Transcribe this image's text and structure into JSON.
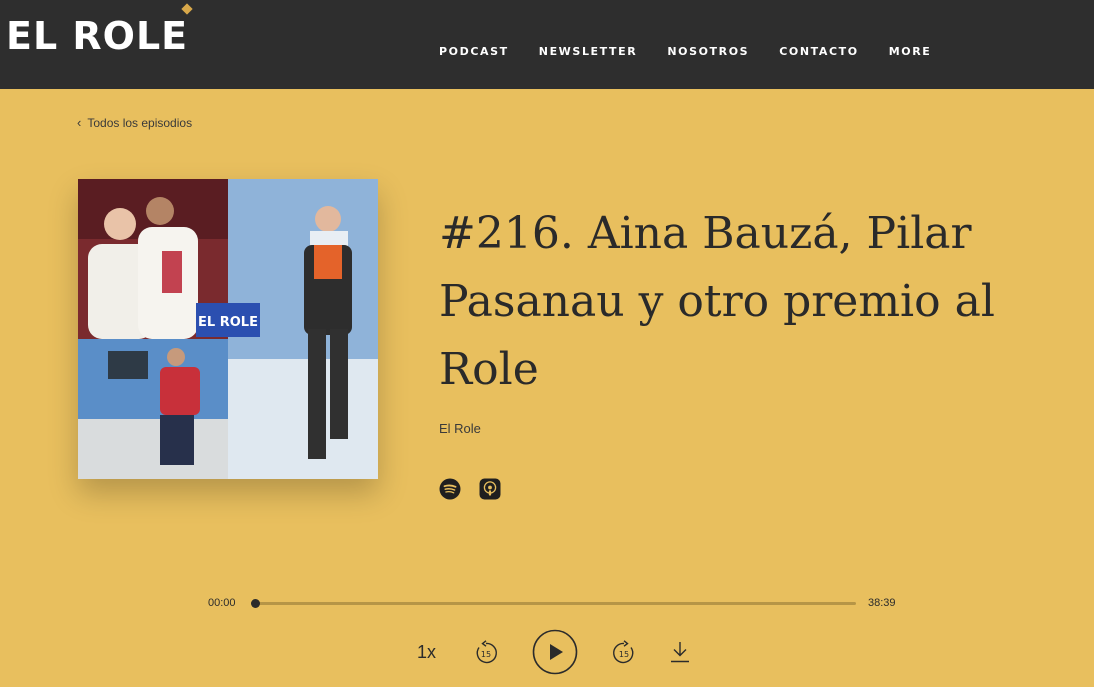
{
  "header": {
    "logo_text": "EL ROLE",
    "nav": [
      "PODCAST",
      "NEWSLETTER",
      "NOSOTROS",
      "CONTACTO",
      "MORE"
    ]
  },
  "back_link": "Todos los episodios",
  "episode": {
    "title": "#216. Aina Bauzá, Pilar Pasanau y otro premio al Role",
    "author": "El Role",
    "cover_logo": "EL ROLE",
    "platforms": [
      {
        "icon": "spotify-icon"
      },
      {
        "icon": "apple-podcasts-icon"
      }
    ]
  },
  "player": {
    "current_time": "00:00",
    "duration": "38:39",
    "progress": 0,
    "speed": "1x",
    "skip_back_seconds": "15",
    "skip_forward_seconds": "15"
  },
  "colors": {
    "background": "#e8bf5e",
    "header": "#2e2e2e",
    "accent": "#d8a84a"
  }
}
